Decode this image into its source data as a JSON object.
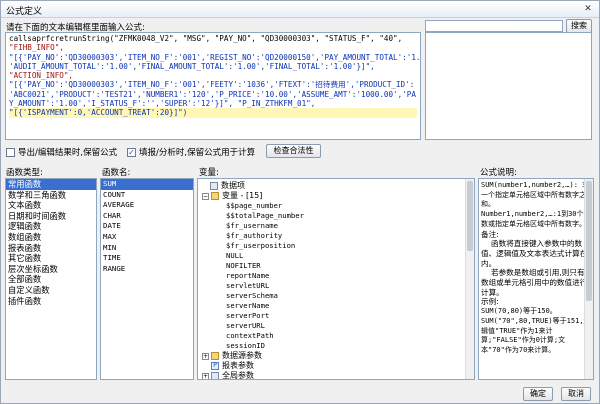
{
  "window": {
    "title": "公式定义",
    "close_glyph": "✕"
  },
  "editor": {
    "prompt": "请在下面的文本编辑框里面输入公式:",
    "lines": [
      "callsaprfcretrunString(\"ZFMK0048_V2\", \"MSG\", \"PAY_NO\", \"QD30000303\", \"STATUS_F\", \"40\",",
      "\"FIHB_INFO\",",
      "\"[{'PAY_NO':'QD30000303','ITEM_NO_F':'001','REGIST_NO':'QD20000150','PAY_AMOUNT_TOTAL':'1.00',",
      "'AUDIT_AMOUNT_TOTAL':'1.00','FINAL_AMOUNT_TOTAL':'1.00','FINAL_TOTAL':'1.00'}]\",",
      "\"ACTION_INFO\",",
      "\"[{'PAY_NO':'QD30000303','ITEM_NO_F':'001','FEETY':'1036','FTEXT':'招待费用','PRODUCT_ID':",
      "'ABC0021','PRODUCT':'TEST21','NUMBER1':'120','P_PRICE':'10.00','ASSUME_AMT':'1000.00','PA",
      "Y_AMOUNT':'1.00','I_STATUS_F':'','SUPER':'12'}]\", \"P_IN_ZTHKFM_01\",",
      "\"[{'ISPAYMENT':0,'ACCOUNT_TREAT':20}]\")"
    ]
  },
  "search": {
    "value": "",
    "button_label": "搜索"
  },
  "options": {
    "cb1_label": "导出/编辑结果时,保留公式",
    "cb1_checked_glyph": "",
    "cb2_label": "填报/分析时,保留公式用于计算",
    "cb2_checked_glyph": "✓",
    "validate_label": "检查合法性"
  },
  "func_types": {
    "header": "函数类型:",
    "items": [
      "常用函数",
      "数学和三角函数",
      "文本函数",
      "日期和时间函数",
      "逻辑函数",
      "数组函数",
      "报表函数",
      "其它函数",
      "层次坐标函数",
      "全部函数",
      "自定义函数",
      "插件函数"
    ]
  },
  "func_names": {
    "header": "函数名:",
    "items": [
      "SUM",
      "COUNT",
      "AVERAGE",
      "CHAR",
      "DATE",
      "MAX",
      "MIN",
      "TIME",
      "RANGE"
    ]
  },
  "vars": {
    "header": "变量:",
    "root": "数据项",
    "var_group": "变量 - [15]",
    "children": [
      "$$page_number",
      "$$totalPage_number",
      "$fr_username",
      "$fr_authority",
      "$fr_userposition",
      "NULL",
      "NOFILTER",
      "reportName",
      "servletURL",
      "serverSchema",
      "serverName",
      "serverPort",
      "serverURL",
      "contextPath",
      "sessionID"
    ],
    "ds_params": "数据源参数",
    "report_params": "报表参数",
    "global_params": "全局参数"
  },
  "desc": {
    "header": "公式说明:",
    "l1": "SUM(number1,number2,…): 求一个指定单元格区域中所有数字之和。",
    "l2": "Number1,number2,…:1到30个参数或指定单元格区域中所有数字。",
    "l3": "备注:",
    "l4": "函数将直接键入参数中的数值、逻辑值及文本表达式计算在内。",
    "l5": "若参数是数组或引用,则只有数组或单元格引用中的数值进行计算。",
    "l6": "示例:",
    "l7": "SUM(70,80)等于150。",
    "l8": "SUM(\"70\",80,TRUE)等于151,逻辑值\"TRUE\"作为1来计算;\"FALSE\"作为0计算;文本\"70\"作为70来计算。"
  },
  "buttons": {
    "ok": "确定",
    "cancel": "取消"
  }
}
